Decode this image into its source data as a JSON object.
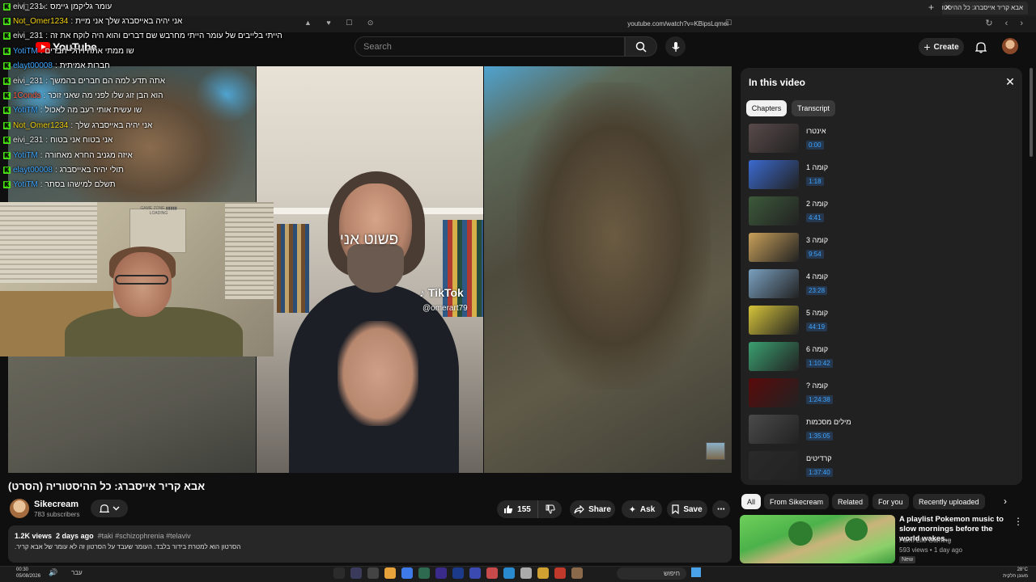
{
  "browser": {
    "tab_title": "אבא קריר אייסברג: כל ההיסטוריה",
    "tab_close": "✕",
    "new_tab": "+",
    "url": "youtube.com/watch?v=KBipsLqmel",
    "window_controls": "— ☐ ✕",
    "nav_icons": "↻ ‹ ›",
    "ext_icons": "▲ ♥ ☐ ⊙"
  },
  "header": {
    "logo_text": "YouTube",
    "search_placeholder": "Search",
    "create_label": "Create"
  },
  "chat": [
    {
      "user": "eivi_231",
      "msg": "עומר גליקמן גיימס",
      "color": "#e8e8e8"
    },
    {
      "user": "Not_Omer1234",
      "msg": "אני יהיה באייסברג שלך אני מיית",
      "color": "#f5d312"
    },
    {
      "user": "eivi_231",
      "msg": "הייתי בלייבים של עומר הייתי מחרבש שם דברים והוא היה לוקח את זה",
      "color": "#e8e8e8"
    },
    {
      "user": "YotiTM",
      "msg": "שו ממתי אתה ויהלי חברים",
      "color": "#3ea6ff"
    },
    {
      "user": "elayt00008",
      "msg": "חברות אמיתית",
      "color": "#3ea6ff"
    },
    {
      "user": "eivi_231",
      "msg": "אתה תדע למה הם חברים בהמשך",
      "color": "#e8e8e8"
    },
    {
      "user": "1Conds",
      "msg": "הוא הבן זוג שלו לפני מה שאני זוכר",
      "color": "#ff5a3c"
    },
    {
      "user": "YotiTM",
      "msg": "שו עשית אותי רעב מה לאכול",
      "color": "#3ea6ff"
    },
    {
      "user": "Not_Omer1234",
      "msg": "אני יהיה באייסברג שלך",
      "color": "#f5d312"
    },
    {
      "user": "eivi_231",
      "msg": "אני בטוח אני בטוח",
      "color": "#e8e8e8"
    },
    {
      "user": "YotiTM",
      "msg": "איזה מגניב החרא מאחורה",
      "color": "#3ea6ff"
    },
    {
      "user": "elayt00008",
      "msg": "תולי יהיה באייסברג",
      "color": "#3ea6ff"
    },
    {
      "user": "YotiTM",
      "msg": "תשלם למישהו בסתר",
      "color": "#3ea6ff"
    }
  ],
  "video": {
    "caption": "פשוט אני",
    "tiktok_label": "TikTok",
    "tiktok_user": "@omerart79",
    "webcam_sign": "GAME ZONE ▮▮▮▮▮ LOADING",
    "title": "אבא קריר אייסברג: כל ההיסטוריה (הסרט)",
    "channel": "Sikecream",
    "subscribers": "783 subscribers",
    "likes": "155",
    "share_label": "Share",
    "ask_label": "Ask",
    "save_label": "Save",
    "more_label": "⋯"
  },
  "description": {
    "views": "1.2K views",
    "age": "2 days ago",
    "tags": "#taki #schizophrenia #telaviv",
    "text": "הסרטון הוא למטרת בידור בלבד. העומר שעבד על הסרטון זה לא עומר של אבא קריר."
  },
  "panel": {
    "title": "In this video",
    "close": "✕",
    "tab_chapters": "Chapters",
    "tab_transcript": "Transcript",
    "chapters": [
      {
        "title": "אינטרו",
        "time": "0:00",
        "color": "#5a4a4a"
      },
      {
        "title": "קומה 1",
        "time": "1:18",
        "color": "#3b6ad0"
      },
      {
        "title": "קומה 2",
        "time": "4:41",
        "color": "#3c5a3a"
      },
      {
        "title": "קומה 3",
        "time": "9:54",
        "color": "#c8a05a"
      },
      {
        "title": "קומה 4",
        "time": "23:28",
        "color": "#7aa0c0"
      },
      {
        "title": "קומה 5",
        "time": "44:19",
        "color": "#d6c43a"
      },
      {
        "title": "קומה 6",
        "time": "1:10:42",
        "color": "#3aa070"
      },
      {
        "title": "קומה ?",
        "time": "1:24:38",
        "color": "#5a0a0a"
      },
      {
        "title": "מילים מסכמות",
        "time": "1:35:05",
        "color": "#4a4a4a"
      },
      {
        "title": "קרדיטים",
        "time": "1:37:40",
        "color": "#2a2a2a"
      }
    ]
  },
  "chips": [
    "All",
    "From Sikecream",
    "Related",
    "For you",
    "Recently uploaded"
  ],
  "chip_next": "›",
  "recommendation": {
    "title": "A playlist Pokemon music to slow mornings before the world wakes...",
    "channel": "Farm Life Gaming",
    "views": "593 views • 1 day ago",
    "badge": "New",
    "more": "⋮"
  },
  "taskbar": {
    "time": "00:30",
    "date": "05/08/2026",
    "lang": "עבר",
    "search_label": "חיפוש",
    "weather_temp": "28°C",
    "weather_desc": "מעונן חלקית"
  }
}
